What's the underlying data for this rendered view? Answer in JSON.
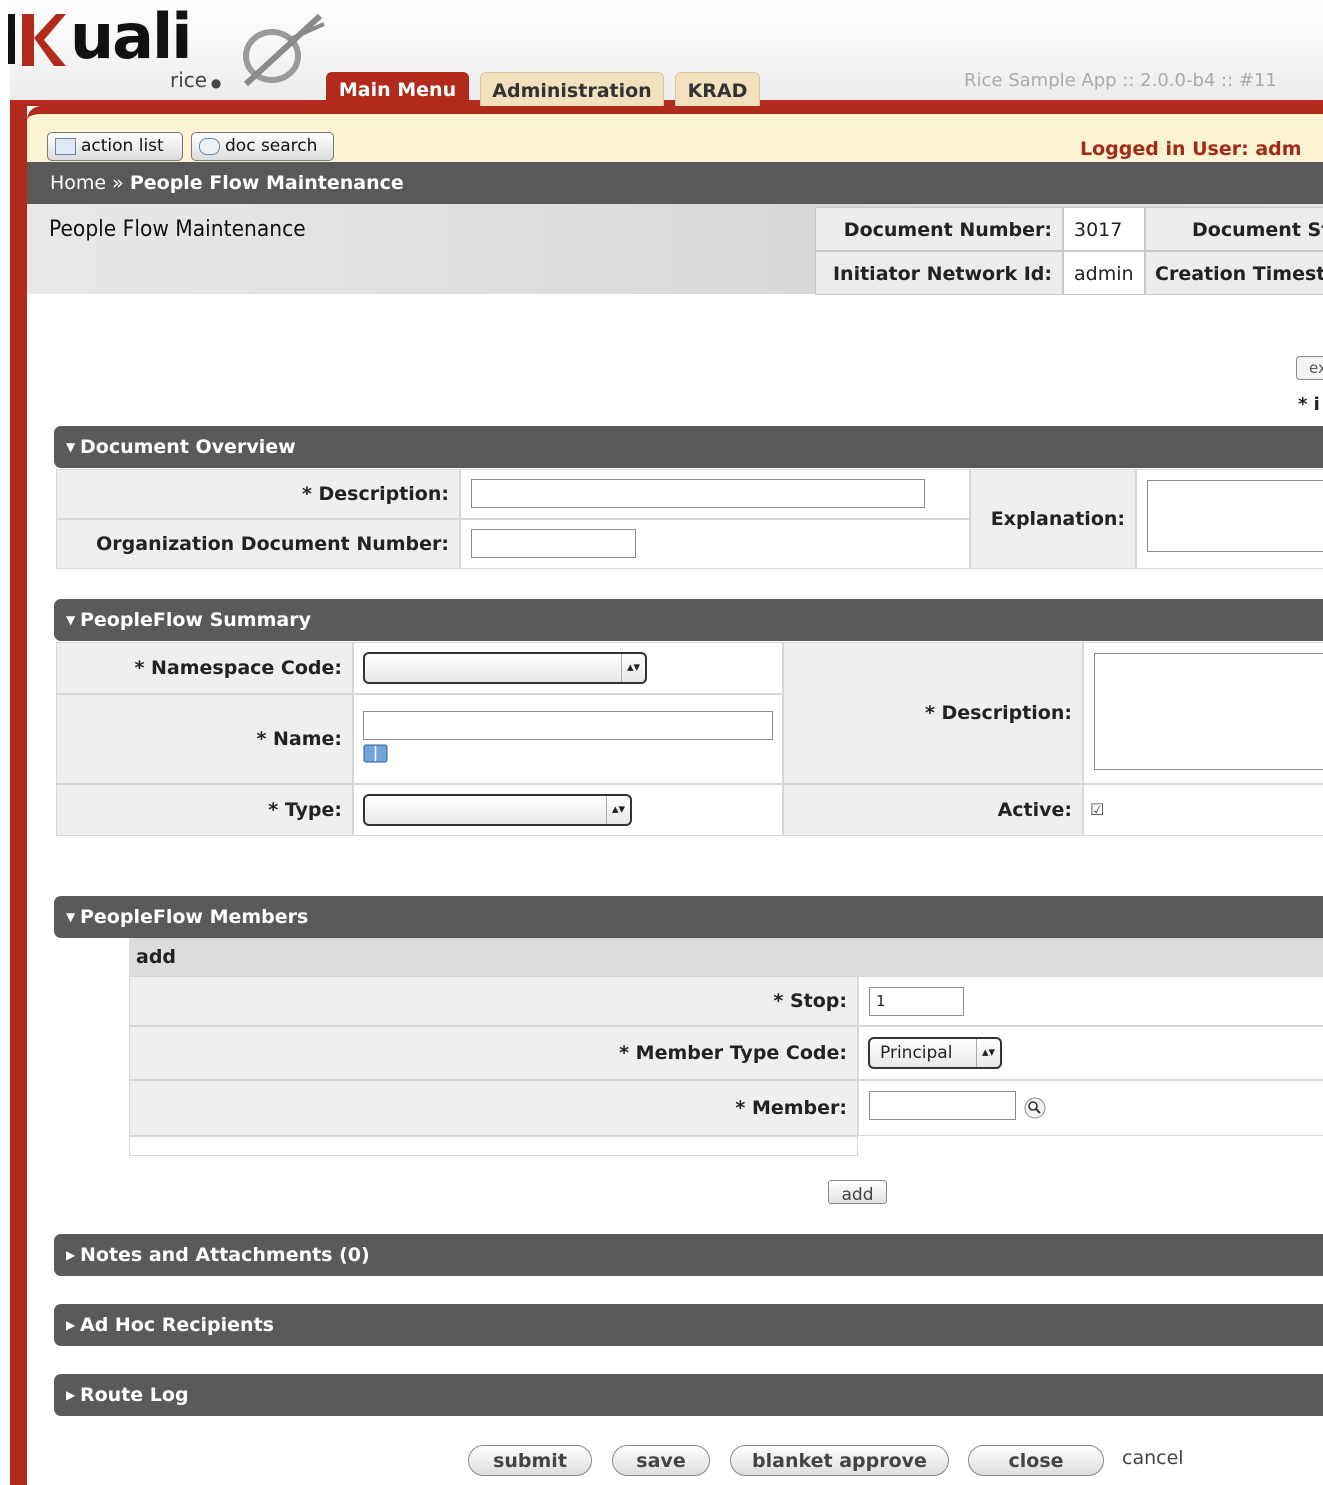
{
  "header": {
    "logo_text": "uali",
    "logo_sub": "rice",
    "tabs": [
      "Main Menu",
      "Administration",
      "KRAD"
    ],
    "app_version": "Rice Sample App :: 2.0.0-b4 :: #11"
  },
  "utility": {
    "action_list": "action list",
    "doc_search": "doc search",
    "logged_in": "Logged in User: adm"
  },
  "breadcrumb": {
    "home": "Home",
    "separator": "»",
    "current": "People Flow Maintenance"
  },
  "page_title": "People Flow Maintenance",
  "doc_header": {
    "document_number_label": "Document Number:",
    "document_number": "3017",
    "document_status_label": "Document St",
    "initiator_label": "Initiator Network Id:",
    "initiator": "admin",
    "creation_label": "Creation Timest"
  },
  "expand_label": "ex",
  "required_note": "* i",
  "doc_overview": {
    "title": "Document Overview",
    "description_label": "* Description:",
    "description_value": "",
    "org_doc_number_label": "Organization Document Number:",
    "org_doc_number_value": "",
    "explanation_label": "Explanation:"
  },
  "summary": {
    "title": "PeopleFlow Summary",
    "namespace_label": "* Namespace Code:",
    "namespace_value": "",
    "name_label": "* Name:",
    "name_value": "",
    "type_label": "* Type:",
    "type_value": "",
    "description_label": "* Description:",
    "active_label": "Active:",
    "active_mark": "☑",
    "active": true
  },
  "members": {
    "title": "PeopleFlow Members",
    "add_header": "add",
    "stop_label": "* Stop:",
    "stop_value": "1",
    "member_type_label": "* Member Type Code:",
    "member_type_value": "Principal",
    "member_label": "* Member:",
    "member_value": "",
    "add_button": "add"
  },
  "collapsed_sections": [
    "Notes and Attachments (0)",
    "Ad Hoc Recipients",
    "Route Log"
  ],
  "actions": {
    "submit": "submit",
    "save": "save",
    "blanket_approve": "blanket approve",
    "close": "close",
    "cancel": "cancel"
  },
  "colors": {
    "brand_red": "#b22a1b",
    "section_gray": "#5a5a5a",
    "utility_bg": "#fbf3d2",
    "tab_inactive": "#f1e2bd"
  }
}
